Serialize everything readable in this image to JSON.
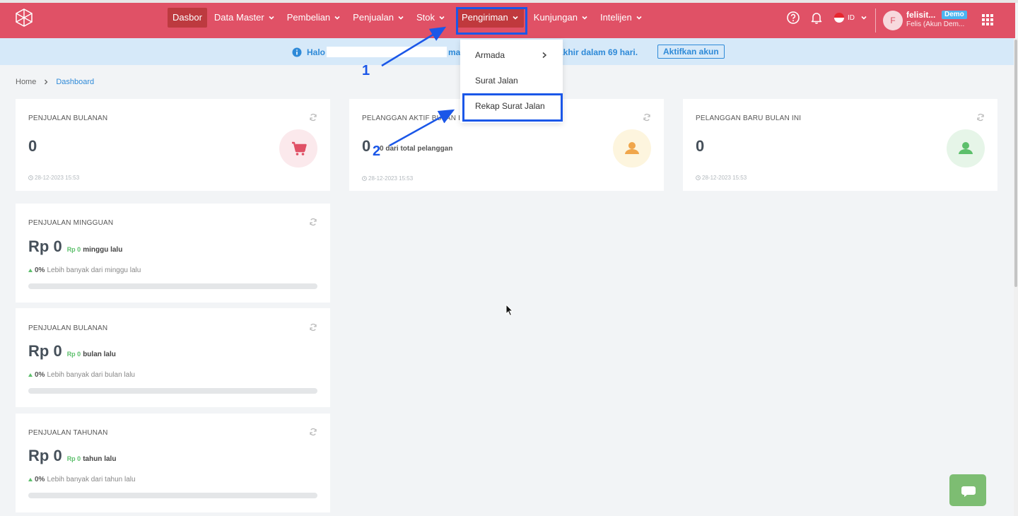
{
  "nav": {
    "items": [
      {
        "label": "Dasbor",
        "has_caret": false
      },
      {
        "label": "Data Master",
        "has_caret": true
      },
      {
        "label": "Pembelian",
        "has_caret": true
      },
      {
        "label": "Penjualan",
        "has_caret": true
      },
      {
        "label": "Stok",
        "has_caret": true
      },
      {
        "label": "Pengiriman",
        "has_caret": true
      },
      {
        "label": "Kunjungan",
        "has_caret": true
      },
      {
        "label": "Intelijen",
        "has_caret": true
      }
    ],
    "active": "Dasbor",
    "open": "Pengiriman"
  },
  "header": {
    "language": "ID",
    "user_initial": "F",
    "user_name": "felisit...",
    "badge": "Demo",
    "user_org": "Felis (Akun Dem..."
  },
  "banner": {
    "greeting": "Halo",
    "middle_fragment": "ma",
    "trial_text": "akhir dalam 69 hari.",
    "activate_label": "Aktifkan akun"
  },
  "breadcrumb": {
    "home": "Home",
    "current": "Dashboard"
  },
  "dropdown": {
    "items": [
      "Armada",
      "Surat Jalan",
      "Rekap Surat Jalan"
    ]
  },
  "annotations": {
    "step1": "1",
    "step2": "2"
  },
  "stat_cards": [
    {
      "title": "PENJUALAN BULANAN",
      "value": "0",
      "timestamp": "28-12-2023 15:53",
      "icon": "cart-icon"
    },
    {
      "title": "PELANGGAN AKTIF BULAN INI",
      "value": "0",
      "note_value": "0",
      "note": "dari total pelanggan",
      "timestamp": "28-12-2023 15:53",
      "icon": "user-icon"
    },
    {
      "title": "PELANGGAN BARU BULAN INI",
      "value": "0",
      "timestamp": "28-12-2023 15:53",
      "icon": "user-icon"
    }
  ],
  "sales_cards": [
    {
      "title": "PENJUALAN MINGGUAN",
      "value": "Rp 0",
      "prev": "Rp 0",
      "period": "minggu lalu",
      "pct": "0%",
      "pct_text": "Lebih banyak dari minggu lalu",
      "progress": 0
    },
    {
      "title": "PENJUALAN BULANAN",
      "value": "Rp 0",
      "prev": "Rp 0",
      "period": "bulan lalu",
      "pct": "0%",
      "pct_text": "Lebih banyak dari bulan lalu",
      "progress": 0
    },
    {
      "title": "PENJUALAN TAHUNAN",
      "value": "Rp 0",
      "prev": "Rp 0",
      "period": "tahun lalu",
      "pct": "0%",
      "pct_text": "Lebih banyak dari tahun lalu",
      "progress": 0
    }
  ],
  "colors": {
    "brand": "#e05166",
    "annotation": "#1b57e8",
    "positive": "#5cbf6b"
  }
}
